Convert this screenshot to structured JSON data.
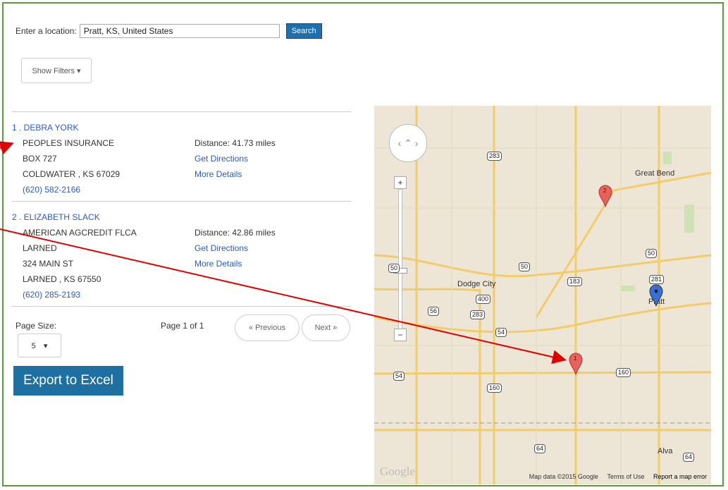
{
  "search": {
    "label": "Enter a location:",
    "value": "Pratt, KS, United States",
    "button": "Search"
  },
  "filters_button": "Show Filters ▾",
  "results": [
    {
      "title": "1 . DEBRA YORK",
      "company": "PEOPLES INSURANCE",
      "address": [
        "BOX 727",
        "COLDWATER , KS 67029"
      ],
      "phone": "(620) 582-2166",
      "distance": "Distance: 41.73 miles",
      "directions": "Get Directions",
      "details": "More Details"
    },
    {
      "title": "2 . ELIZABETH SLACK",
      "company": "AMERICAN AGCREDIT FLCA",
      "address": [
        "LARNED",
        "324 MAIN ST",
        "LARNED , KS 67550"
      ],
      "phone": "(620) 285-2193",
      "distance": "Distance: 42.86 miles",
      "directions": "Get Directions",
      "details": "More Details"
    }
  ],
  "pager": {
    "page_size_label": "Page Size:",
    "page_size": "5",
    "page_info": "Page 1 of 1",
    "prev": "« Previous",
    "next": "Next »"
  },
  "export_label": "Export to Excel",
  "map": {
    "cities": [
      "Great Bend",
      "Dodge City",
      "Pratt",
      "Alva"
    ],
    "highway_shields": [
      "283",
      "50",
      "50",
      "281",
      "50",
      "183",
      "400",
      "56",
      "283",
      "54",
      "54",
      "160",
      "160",
      "64",
      "64"
    ],
    "marker_labels": [
      "1",
      "2"
    ],
    "google_logo": "Google",
    "footer": [
      "Map data ©2015 Google",
      "Terms of Use",
      "Report a map error"
    ],
    "colors": {
      "road": "#f3cc6a",
      "water_land": "#ede6d6",
      "park": "#cfe2b5",
      "marker_red": "#e8615a",
      "marker_blue": "#3b6fd8"
    }
  },
  "colors": {
    "frame": "#5b9b3a",
    "link": "#2a5cc6",
    "button": "#1e6fa2",
    "annotation_arrow": "#e00000"
  }
}
